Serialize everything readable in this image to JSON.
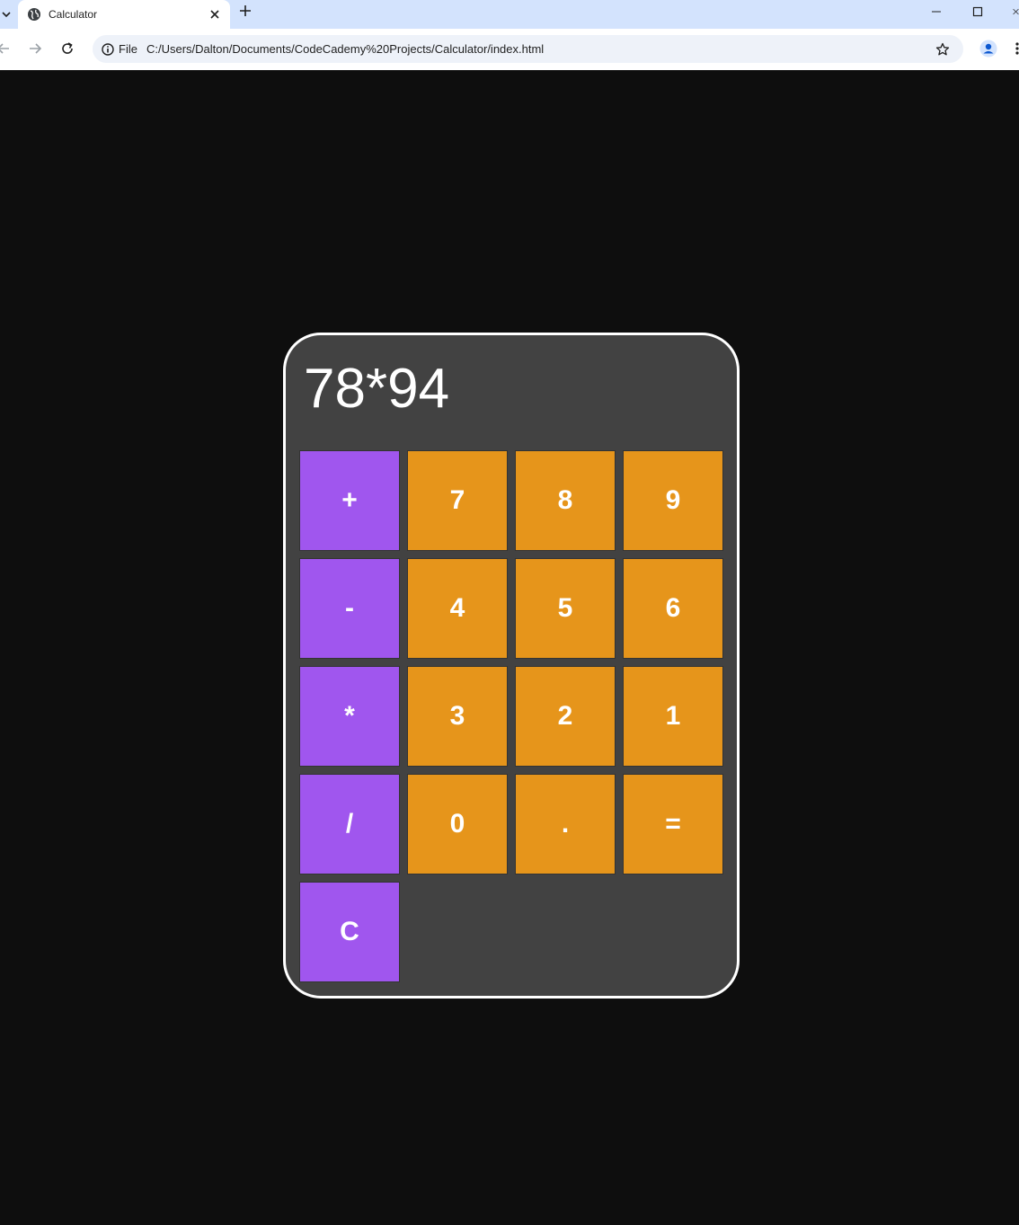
{
  "browser": {
    "tab_title": "Calculator",
    "site_info_label": "File",
    "url": "C:/Users/Dalton/Documents/CodeCademy%20Projects/Calculator/index.html"
  },
  "calculator": {
    "display": "78*94",
    "keys": {
      "plus": "+",
      "seven": "7",
      "eight": "8",
      "nine": "9",
      "minus": "-",
      "four": "4",
      "five": "5",
      "six": "6",
      "multiply": "*",
      "three": "3",
      "two": "2",
      "one": "1",
      "divide": "/",
      "zero": "0",
      "decimal": ".",
      "equals": "=",
      "clear": "C"
    }
  },
  "colors": {
    "operator_key": "#a056ee",
    "number_key": "#e6951b",
    "calculator_body": "#424242",
    "page_background": "#0e0e0e"
  }
}
